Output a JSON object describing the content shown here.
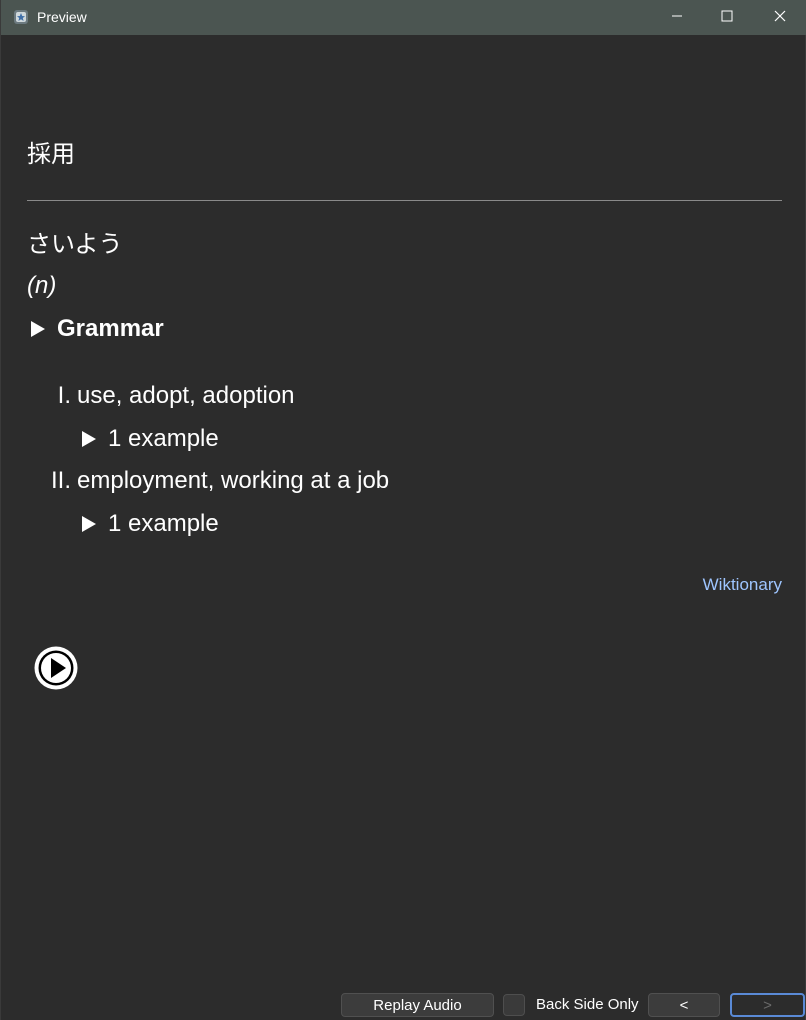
{
  "window": {
    "title": "Preview",
    "icon": "anki-app-icon",
    "controls": [
      "minimize-icon",
      "maximize-icon",
      "close-icon"
    ]
  },
  "card": {
    "front": "採用",
    "reading": "さいよう",
    "part_of_speech": "(n)",
    "grammar_label": "Grammar",
    "senses": [
      {
        "number": "I.",
        "gloss": "use, adopt, adoption",
        "example_label": "1 example"
      },
      {
        "number": "II.",
        "gloss": "employment, working at a job",
        "example_label": "1 example"
      }
    ],
    "source_link": "Wiktionary",
    "play_icon": "play-audio-icon"
  },
  "bottom_bar": {
    "replay_label": "Replay Audio",
    "back_side_only_label": "Back Side Only",
    "back_side_only_checked": false,
    "prev_label": "<",
    "next_label": ">"
  },
  "colors": {
    "titlebar": "#4b5551",
    "background": "#2c2c2c",
    "link": "#9ec5ff",
    "focus_border": "#5a8ad6"
  }
}
